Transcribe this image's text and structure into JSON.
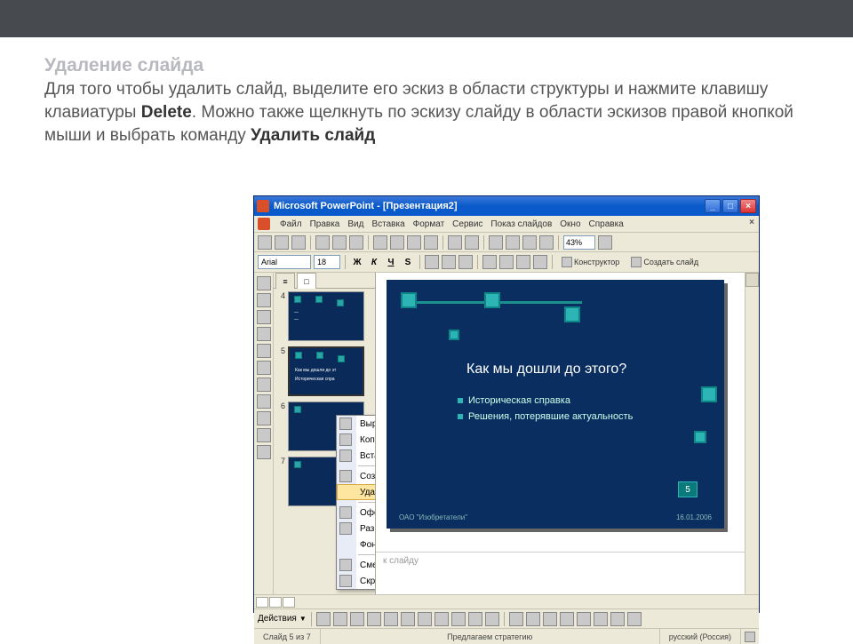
{
  "header": {
    "title": "Удаление слайда",
    "p1_a": "Для того чтобы удалить слайд, выделите его эскиз в области структуры и нажмите клавишу клавиатуры ",
    "p1_b": "Delete",
    "p1_c": ". Можно также щелкнуть по эскизу слайду в области эскизов правой кнопкой мыши и выбрать команду ",
    "p1_d": "Удалить слайд"
  },
  "pp": {
    "title": "Microsoft PowerPoint - [Презентация2]",
    "menu": [
      "Файл",
      "Правка",
      "Вид",
      "Вставка",
      "Формат",
      "Сервис",
      "Показ слайдов",
      "Окно",
      "Справка"
    ],
    "zoom": "43%",
    "font": "Arial",
    "size": "18",
    "fmt": {
      "bold": "Ж",
      "italic": "К",
      "underline": "Ч",
      "shadow": "S"
    },
    "task1": "Конструктор",
    "task2": "Создать слайд",
    "thumbs": [
      "4",
      "5",
      "6",
      "7"
    ],
    "slide": {
      "title": "Как мы дошли до этого?",
      "b1": "Историческая справка",
      "b2": "Решения, потерявшие актуальность",
      "footer_l": "ОАО \"Изобретатели\"",
      "footer_r": "16.01.2006",
      "num": "5"
    },
    "notes": "к слайду",
    "ctx": {
      "cut": "Вырезать",
      "copy": "Копировать",
      "paste": "Вставить",
      "newslide": "Создать слайд",
      "delslide": "Удалить слайд",
      "design": "Оформление слайда...",
      "layout": "Разметка слайда...",
      "bg": "Фон...",
      "trans": "Смена слайдов...",
      "hide": "Скрыть слайд"
    },
    "drawbar": "Действия",
    "status": {
      "slide": "Слайд 5 из 7",
      "design": "Предлагаем стратегию",
      "lang": "русский (Россия)"
    }
  }
}
